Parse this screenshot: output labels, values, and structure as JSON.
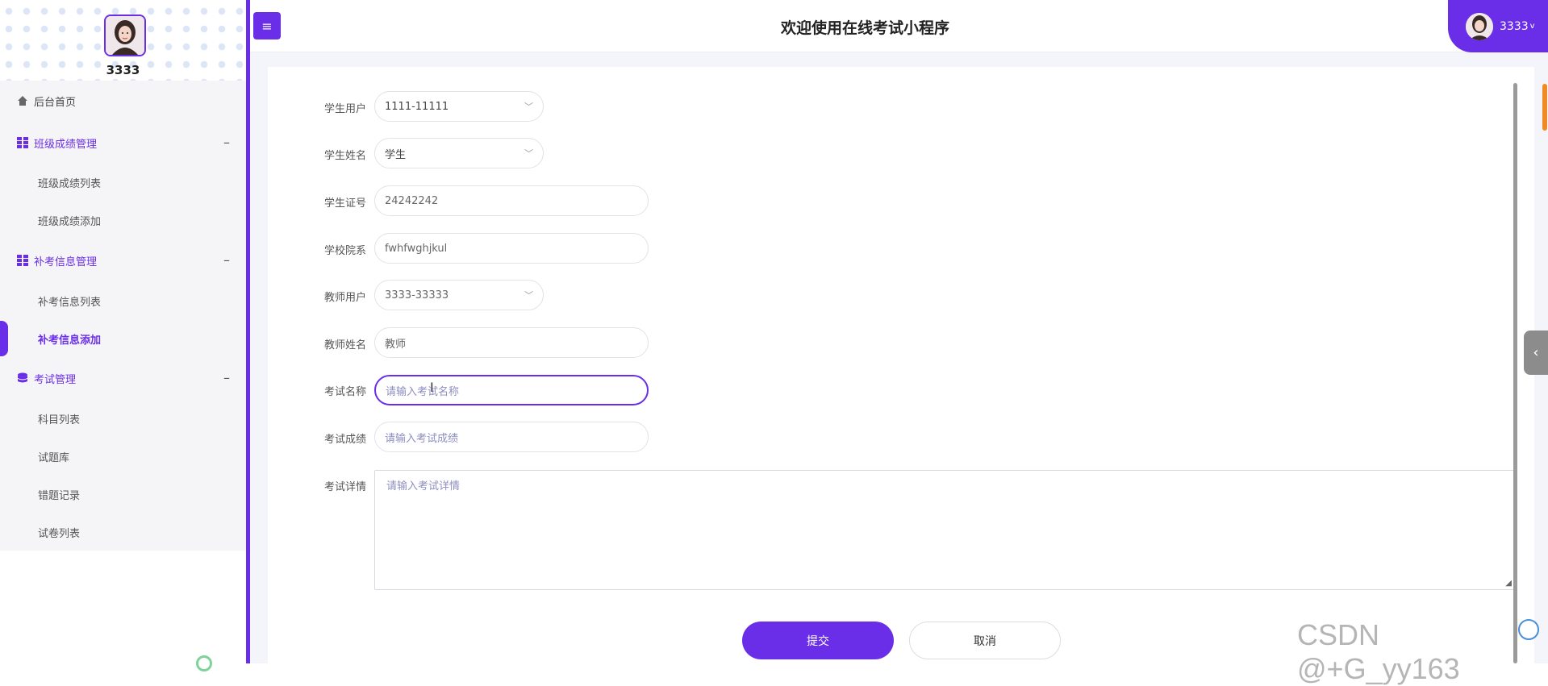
{
  "sidebar": {
    "user_name": "3333",
    "items": [
      {
        "label": "后台首页"
      },
      {
        "label": "班级成绩管理",
        "toggle": "–"
      },
      {
        "label": "班级成绩列表"
      },
      {
        "label": "班级成绩添加"
      },
      {
        "label": "补考信息管理",
        "toggle": "–"
      },
      {
        "label": "补考信息列表"
      },
      {
        "label": "补考信息添加"
      },
      {
        "label": "考试管理",
        "toggle": "–"
      },
      {
        "label": "科目列表"
      },
      {
        "label": "试题库"
      },
      {
        "label": "错题记录"
      },
      {
        "label": "试卷列表"
      }
    ]
  },
  "header": {
    "menu_icon": "≡",
    "title": "欢迎使用在线考试小程序",
    "user_name": "3333",
    "caret": "v"
  },
  "form": {
    "student_user": {
      "label": "学生用户",
      "value": "1111-11111"
    },
    "student_name": {
      "label": "学生姓名",
      "value": "学生"
    },
    "student_id": {
      "label": "学生证号",
      "value": "24242242"
    },
    "school_dept": {
      "label": "学校院系",
      "value": "fwhfwghjkul"
    },
    "teacher_user": {
      "label": "教师用户",
      "value": "3333-33333"
    },
    "teacher_name": {
      "label": "教师姓名",
      "value": "教师"
    },
    "exam_name": {
      "label": "考试名称",
      "placeholder": "请输入考试名称"
    },
    "exam_score": {
      "label": "考试成绩",
      "placeholder": "请输入考试成绩"
    },
    "exam_detail": {
      "label": "考试详情",
      "placeholder": "请输入考试详情"
    },
    "submit_label": "提交",
    "cancel_label": "取消"
  },
  "watermark": "CSDN @+G_yy163",
  "colors": {
    "accent": "#6a2ee8",
    "sidebar_bg": "#f5f5f7",
    "content_bg": "#f4f5fa"
  },
  "icons": {
    "home": "home-icon",
    "grid": "grid-icon",
    "database": "database-icon",
    "chevron": "chevron-left-icon"
  }
}
